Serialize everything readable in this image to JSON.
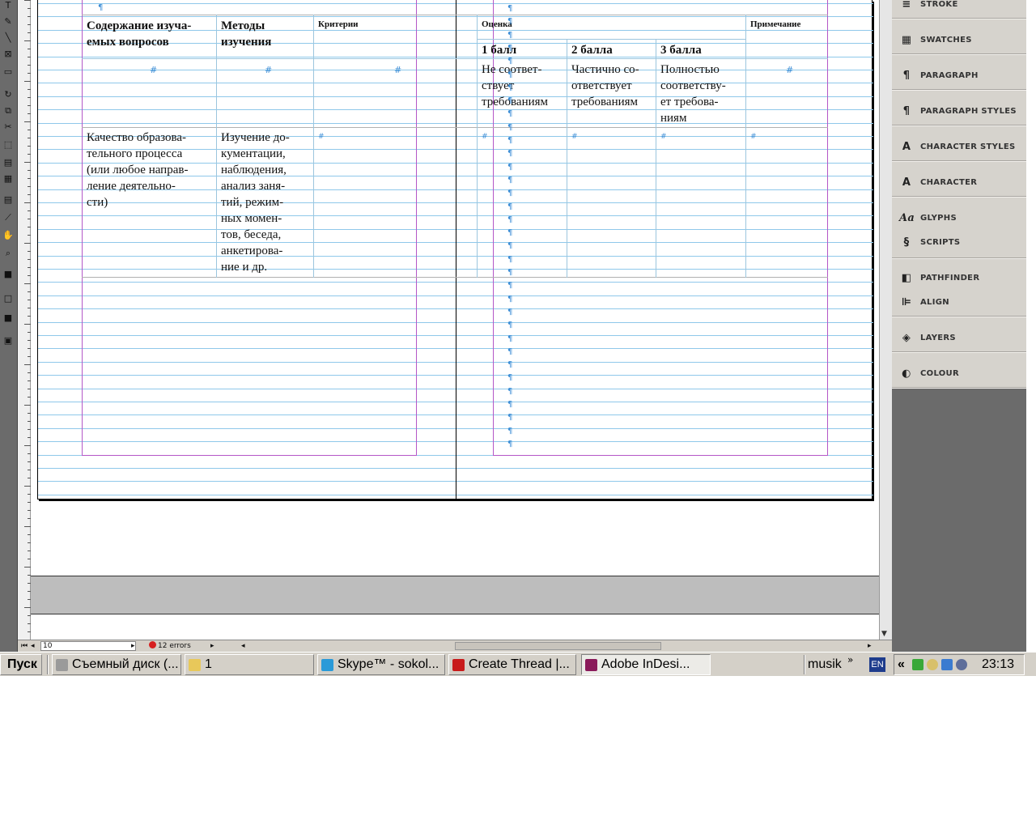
{
  "app": {
    "name": "Adobe InDesign"
  },
  "document": {
    "table": {
      "header": {
        "col1": "Содержание изуча-\nемых вопросов",
        "col2": "Методы\nизучения",
        "col3": "Критерии",
        "col4": "Оценка",
        "col5": "Примечание"
      },
      "subheader": {
        "score1": "1 балл",
        "score2": "2 балла",
        "score3": "3 балла"
      },
      "descr": {
        "score1": "Не соответ-\nствует\nтребованиям",
        "score2": "Частично со-\nответствует\nтребованиям",
        "score3": "Полностью\nсоответству-\nет требова-\nниям"
      },
      "row1": {
        "content": "Качество образова-\nтельного процесса\n(или любое направ-\nление деятельно-\nсти)",
        "methods": "Изучение до-\nкументации,\nнаблюдения,\nанализ заня-\nтий, режим-\nных момен-\nтов, беседа,\nанкетирова-\nние и др."
      }
    }
  },
  "status": {
    "page": "10",
    "errors": "12 errors"
  },
  "panels": [
    {
      "label": "STROKE",
      "icon": "stroke-icon"
    },
    {
      "label": "SWATCHES",
      "icon": "swatches-icon"
    },
    {
      "label": "PARAGRAPH",
      "icon": "paragraph-icon"
    },
    {
      "label": "PARAGRAPH STYLES",
      "icon": "paragraph-styles-icon"
    },
    {
      "label": "CHARACTER STYLES",
      "icon": "character-styles-icon"
    },
    {
      "label": "CHARACTER",
      "icon": "character-icon"
    },
    {
      "label": "GLYPHS",
      "icon": "glyphs-icon"
    },
    {
      "label": "SCRIPTS",
      "icon": "scripts-icon"
    },
    {
      "label": "PATHFINDER",
      "icon": "pathfinder-icon"
    },
    {
      "label": "ALIGN",
      "icon": "align-icon"
    },
    {
      "label": "LAYERS",
      "icon": "layers-icon"
    },
    {
      "label": "COLOUR",
      "icon": "colour-icon"
    }
  ],
  "taskbar": {
    "start": "Пуск",
    "items": [
      {
        "label": "Съемный диск (...",
        "icon": "drive-icon"
      },
      {
        "label": "1",
        "icon": "folder-icon"
      },
      {
        "label": "Skype™ - sokol...",
        "icon": "skype-icon"
      },
      {
        "label": "Create Thread |...",
        "icon": "opera-icon"
      },
      {
        "label": "Adobe InDesi...",
        "icon": "indesign-icon"
      }
    ],
    "user": "musik",
    "lang": "EN",
    "clock": "23:13",
    "tray_expand": "«"
  },
  "colors": {
    "baseline": "#8fc8ea",
    "margin": "#b457c7",
    "hidden_char": "#3d8ed6",
    "panel_bg": "#d6d3cd"
  },
  "marks": {
    "cell_end": "#",
    "para": "¶"
  }
}
